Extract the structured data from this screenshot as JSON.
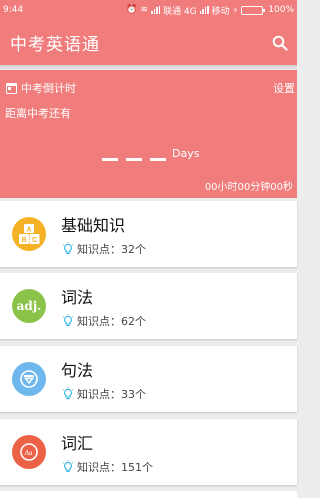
{
  "status_bar": {
    "time": "9:44",
    "carrier1": "联通 4G",
    "carrier2": "移动",
    "battery": "100%"
  },
  "app_bar": {
    "title": "中考英语通",
    "search_icon": "search-icon"
  },
  "countdown": {
    "header": "中考倒计时",
    "settings": "设置",
    "subtitle": "距离中考还有",
    "days_label": "Days",
    "time_remaining": "00小时00分钟00秒"
  },
  "topics": [
    {
      "name": "基础知识",
      "meta": "知识点：32个",
      "icon": "abc-blocks-icon",
      "color": "#f5b227"
    },
    {
      "name": "词法",
      "meta": "知识点：62个",
      "icon": "adj-icon",
      "color": "#8bc34a"
    },
    {
      "name": "句法",
      "meta": "知识点：33个",
      "icon": "sentence-icon",
      "color": "#6fb8ee"
    },
    {
      "name": "词汇",
      "meta": "知识点：151个",
      "icon": "vocabulary-icon",
      "color": "#ec6247"
    }
  ],
  "colors": {
    "primary": "#f07c7c",
    "accent_bulb": "#33b5e5"
  }
}
